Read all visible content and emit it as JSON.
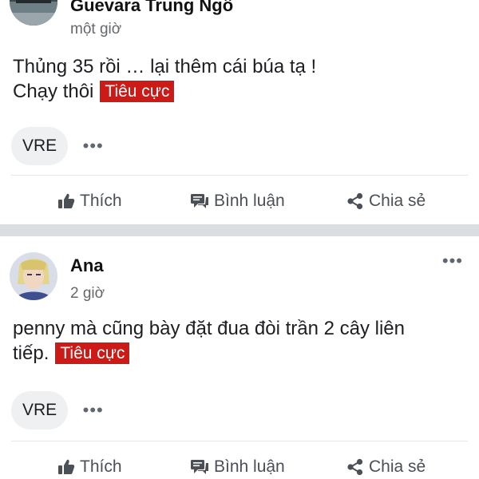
{
  "posts": [
    {
      "author": "Guevara Trung Ngô",
      "time": "một giờ",
      "text_lines": [
        "Thủng 35 rồi … lại thêm cái búa tạ !",
        "Chạy thôi"
      ],
      "tag": "Tiêu cực",
      "ticker": "VRE",
      "ticker_more": "•••",
      "actions": {
        "like": "Thích",
        "comment": "Bình luận",
        "share": "Chia sẻ"
      }
    },
    {
      "author": "Ana",
      "time": "2 giờ",
      "text_lines": [
        "penny mà cũng bày đặt đua đòi trần 2 cây liên",
        "tiếp."
      ],
      "tag": "Tiêu cực",
      "ticker": "VRE",
      "ticker_more": "•••",
      "more_menu": "•••",
      "actions": {
        "like": "Thích",
        "comment": "Bình luận",
        "share": "Chia sẻ"
      }
    }
  ],
  "colors": {
    "tag_bg": "#cc1b17",
    "separator": "#dadde1",
    "chip_bg": "#eef0f2",
    "muted_text": "#65676b"
  }
}
